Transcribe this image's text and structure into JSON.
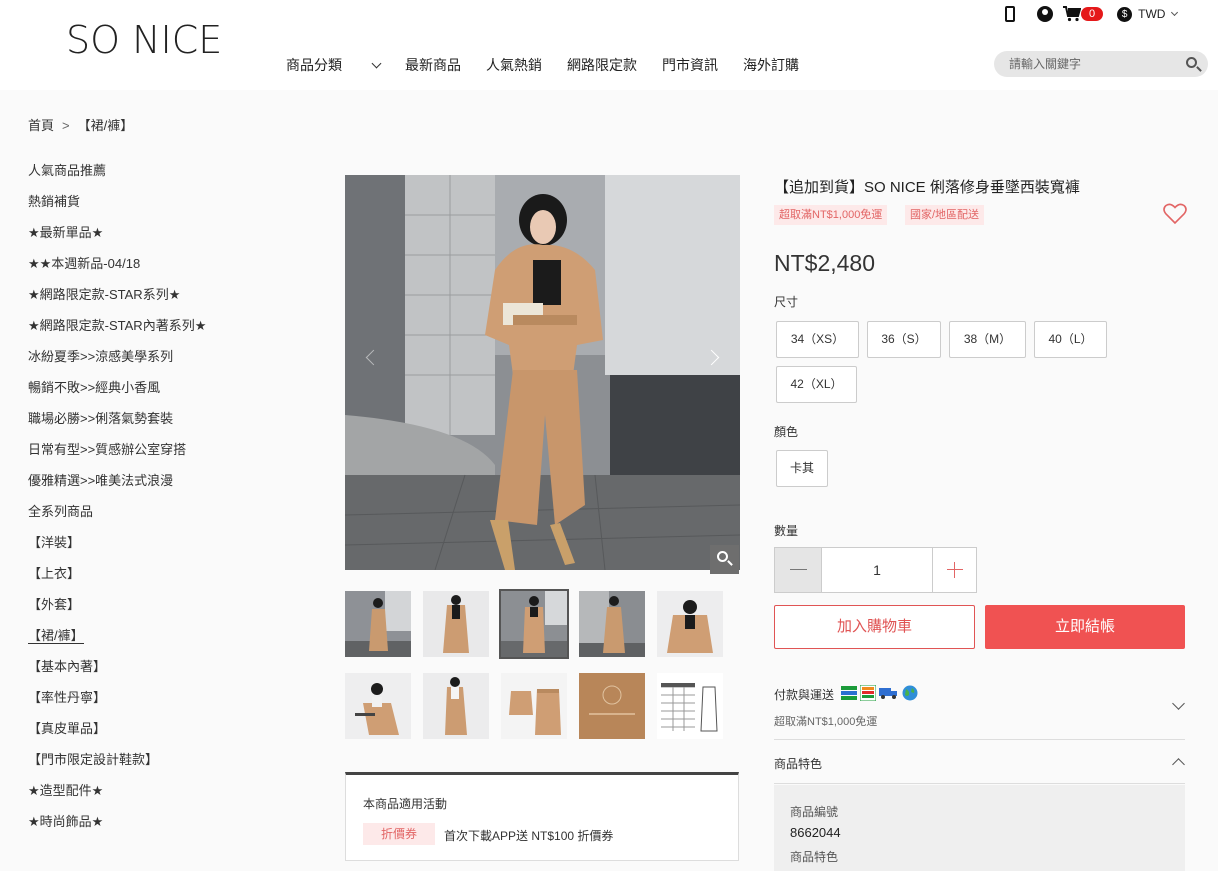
{
  "header": {
    "logo": "SO NICE",
    "nav": [
      "商品分類",
      "最新商品",
      "人氣熱銷",
      "網路限定款",
      "門市資訊",
      "海外訂購"
    ],
    "cart_count": "0",
    "currency": "TWD",
    "search_placeholder": "請輸入關鍵字"
  },
  "breadcrumb": {
    "home": "首頁",
    "current": "【裙/褲】"
  },
  "sidebar": {
    "items": [
      "人氣商品推薦",
      "熱銷補貨",
      "★最新單品★",
      "★★本週新品-04/18",
      "★網路限定款-STAR系列★",
      "★網路限定款-STAR內著系列★",
      "冰紛夏季>>涼感美學系列",
      "暢銷不敗>>經典小香風",
      "職場必勝>>俐落氣勢套裝",
      "日常有型>>質感辦公室穿搭",
      "優雅精選>>唯美法式浪漫",
      "全系列商品",
      "【洋裝】",
      "【上衣】",
      "【外套】",
      "【裙/褲】",
      "【基本內著】",
      "【率性丹寧】",
      "【真皮單品】",
      "【門市限定設計鞋款】",
      "★造型配件★",
      "★時尚飾品★"
    ],
    "active_index": 15
  },
  "gallery": {
    "selected_thumb": 2
  },
  "promo": {
    "title": "本商品適用活動",
    "tag": "折價券",
    "text": "首次下載APP送 NT$100 折價券"
  },
  "product": {
    "title": "【追加到貨】SO NICE 俐落修身垂墜西裝寬褲",
    "tags": [
      "超取滿NT$1,000免運",
      "國家/地區配送"
    ],
    "price": "NT$2,480",
    "size_label": "尺寸",
    "sizes": [
      "34（XS）",
      "36（S）",
      "38（M）",
      "40（L）",
      "42（XL）"
    ],
    "color_label": "顏色",
    "colors": [
      "卡其"
    ],
    "qty_label": "數量",
    "qty": "1",
    "add_to_cart": "加入購物車",
    "buy_now": "立即結帳",
    "payment_title": "付款與運送",
    "payment_sub": "超取滿NT$1,000免運",
    "features_title": "商品特色",
    "product_no_label": "商品編號",
    "product_no": "8662044",
    "feature_label": "商品特色"
  },
  "colors": {
    "accent": "#f05252",
    "tag_bg": "#fde9e9",
    "tag_text": "#e26565"
  }
}
